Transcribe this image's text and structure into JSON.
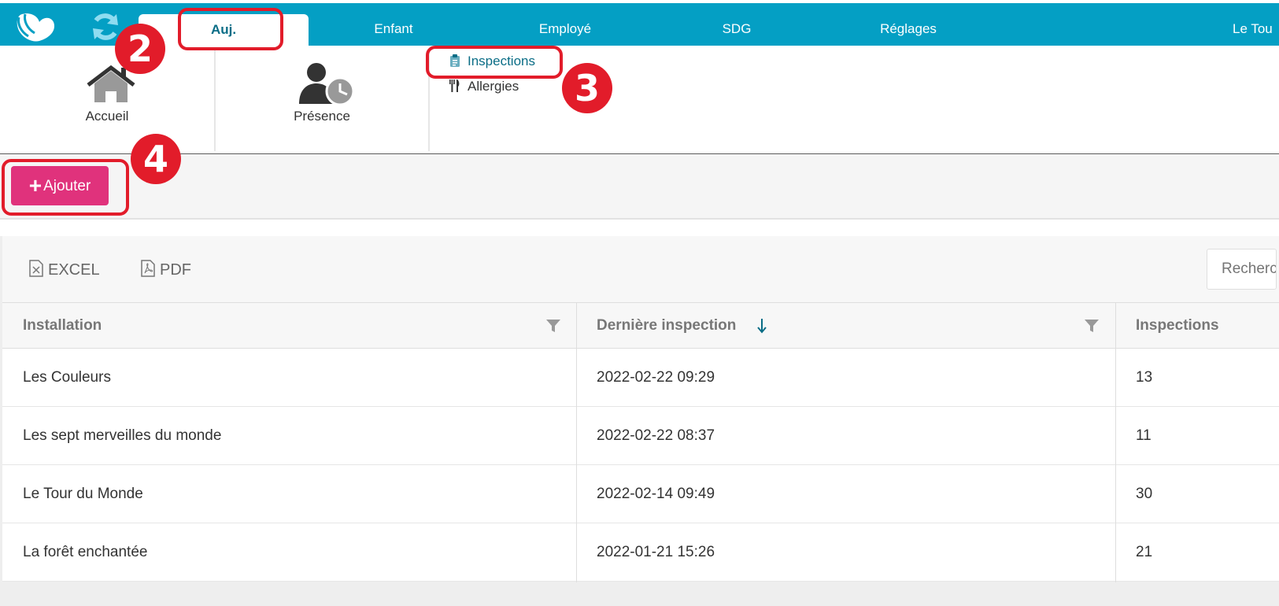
{
  "topnav": {
    "tabs": [
      {
        "label": "Auj.",
        "active": true
      },
      {
        "label": "Enfant"
      },
      {
        "label": "Employé"
      },
      {
        "label": "SDG"
      },
      {
        "label": "Réglages"
      },
      {
        "label": "Le Tou"
      }
    ],
    "brand_color": "#049fc4"
  },
  "subnav": {
    "tiles": [
      {
        "label": "Accueil",
        "icon": "home-icon"
      },
      {
        "label": "Présence",
        "icon": "person-clock-icon"
      }
    ],
    "links": [
      {
        "label": "Inspections",
        "icon": "clipboard-icon",
        "active": true
      },
      {
        "label": "Allergies",
        "icon": "fork-knife-icon"
      }
    ]
  },
  "toolbar": {
    "add_label": "Ajouter",
    "add_color": "#e0327c"
  },
  "grid": {
    "exports": [
      "EXCEL",
      "PDF"
    ],
    "search_placeholder": "Recherc",
    "columns": [
      "Installation",
      "Dernière inspection",
      "Inspections"
    ],
    "rows": [
      [
        "Les Couleurs",
        "2022-02-22 09:29",
        "13"
      ],
      [
        "Les sept merveilles du monde",
        "2022-02-22 08:37",
        "11"
      ],
      [
        "Le Tour du Monde",
        "2022-02-14 09:49",
        "30"
      ],
      [
        "La forêt enchantée",
        "2022-01-21 15:26",
        "21"
      ]
    ]
  },
  "callouts": [
    "2",
    "3",
    "4"
  ],
  "callout_color": "#e21c2a"
}
